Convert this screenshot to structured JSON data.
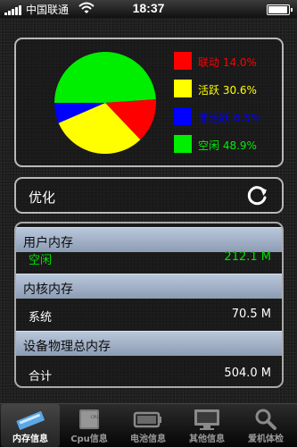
{
  "status_bar": {
    "carrier": "中国联通",
    "time": "18:37"
  },
  "chart_data": {
    "type": "pie",
    "categories": [
      "联动",
      "活跃",
      "非活跃",
      "空闲"
    ],
    "values": [
      14.0,
      30.6,
      6.5,
      48.9
    ],
    "colors": [
      "#ff0000",
      "#ffff00",
      "#0000ff",
      "#00ee00"
    ],
    "legend_labels": [
      "联动 14.0%",
      "活跃 30.6%",
      "非活跃 6.5%",
      "空闲 48.9%"
    ],
    "legend_placement": "right"
  },
  "optimize": {
    "label": "优化"
  },
  "memory": {
    "user_header": "用户内存",
    "free_label": "空闲",
    "free_value": "212.1 M",
    "kernel_header": "内核内存",
    "system_label": "系统",
    "system_value": "70.5 M",
    "physical_header": "设备物理总内存",
    "total_label": "合计",
    "total_value": "504.0 M"
  },
  "tabbar": {
    "tabs": [
      {
        "label": "内存信息",
        "icon": "memory-chip-icon",
        "active": true
      },
      {
        "label": "Cpu信息",
        "icon": "cpu-icon",
        "active": false
      },
      {
        "label": "电池信息",
        "icon": "battery-icon",
        "active": false
      },
      {
        "label": "其他信息",
        "icon": "monitor-icon",
        "active": false
      },
      {
        "label": "爱机体检",
        "icon": "magnifier-icon",
        "active": false
      }
    ]
  }
}
